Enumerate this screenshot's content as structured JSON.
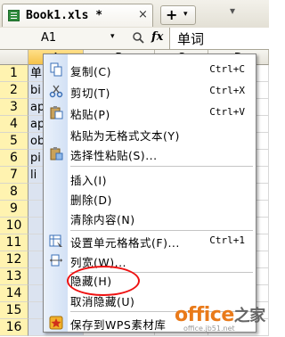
{
  "tab": {
    "filename": "Book1.xls *",
    "close": "×"
  },
  "new_tab": {
    "plus": "+",
    "dropdown": "▾"
  },
  "tab_scroll": "▾",
  "formula_bar": {
    "cell_ref": "A1",
    "cell_ref_arrow": "▾",
    "zoom_icon": "🔍",
    "fx": "fx",
    "content": "单词"
  },
  "columns": [
    "A",
    "B",
    "C",
    "D"
  ],
  "rows": [
    "1",
    "2",
    "3",
    "4",
    "5",
    "6",
    "7",
    "8",
    "9",
    "10",
    "11",
    "12",
    "13",
    "14",
    "15",
    "16"
  ],
  "cells_colA": [
    "单",
    "bi",
    "ap",
    "ap",
    "ob",
    "pi",
    "li",
    "",
    "",
    "",
    "",
    "",
    "",
    "",
    "",
    ""
  ],
  "menu": {
    "items": [
      {
        "label": "复制(C)",
        "shortcut": "Ctrl+C",
        "icon": "copy-icon"
      },
      {
        "label": "剪切(T)",
        "shortcut": "Ctrl+X",
        "icon": "cut-icon"
      },
      {
        "label": "粘贴(P)",
        "shortcut": "Ctrl+V",
        "icon": "paste-icon"
      },
      {
        "label": "粘贴为无格式文本(Y)",
        "shortcut": "",
        "icon": ""
      },
      {
        "label": "选择性粘贴(S)...",
        "shortcut": "",
        "icon": "paste-special-icon"
      },
      {
        "label": "插入(I)",
        "shortcut": "",
        "icon": ""
      },
      {
        "label": "删除(D)",
        "shortcut": "",
        "icon": ""
      },
      {
        "label": "清除内容(N)",
        "shortcut": "",
        "icon": ""
      },
      {
        "label": "设置单元格格式(F)...",
        "shortcut": "Ctrl+1",
        "icon": "format-cells-icon"
      },
      {
        "label": "列宽(W)...",
        "shortcut": "",
        "icon": "column-width-icon"
      },
      {
        "label": "隐藏(H)",
        "shortcut": "",
        "icon": ""
      },
      {
        "label": "取消隐藏(U)",
        "shortcut": "",
        "icon": ""
      },
      {
        "label": "保存到WPS素材库",
        "shortcut": "",
        "icon": "save-library-icon"
      }
    ]
  },
  "watermark": {
    "brand": "office",
    "zh": "之家",
    "url": "office.jb51.net"
  }
}
